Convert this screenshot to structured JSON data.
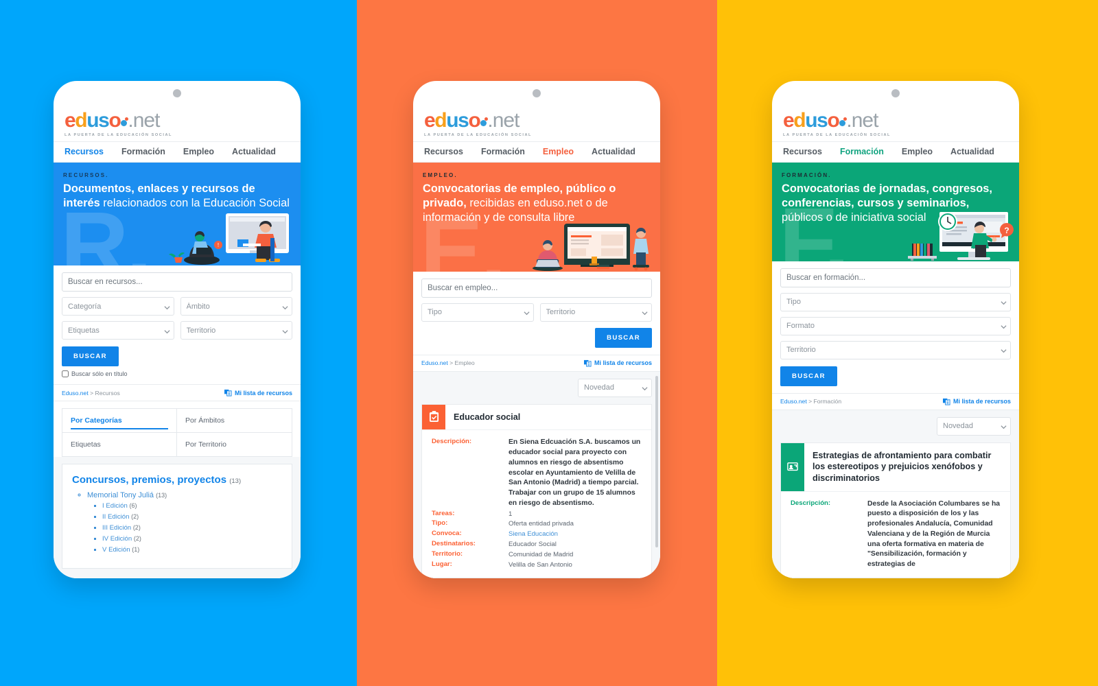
{
  "background": {
    "panel_blue": "#00A6FB",
    "panel_orange": "#FD7643",
    "panel_yellow": "#FFC107"
  },
  "brand": {
    "word_e": "e",
    "word_d": "d",
    "word_u": "u",
    "word_s": "s",
    "word_o": "o",
    "word_net": ".net",
    "tagline": "LA PUERTA DE LA EDUCACIÓN SOCIAL"
  },
  "nav": {
    "recursos": "Recursos",
    "formacion": "Formación",
    "empleo": "Empleo",
    "actualidad": "Actualidad"
  },
  "common": {
    "buscar_button": "BUSCAR",
    "mi_lista": "Mi lista de recursos",
    "sort_value": "Novedad",
    "crumb_root": "Eduso.net",
    "crumb_sep": " > "
  },
  "phone1": {
    "accent": "#1C8EF0",
    "hero": {
      "kicker": "RECURSOS.",
      "title_bold": "Documentos, enlaces y recursos de interés",
      "title_rest": " relacionados con la Educación Social",
      "ghost": "R."
    },
    "search": {
      "placeholder": "Buscar en recursos...",
      "select_categoria": "Categoría",
      "select_ambito": "Ámbito",
      "select_etiquetas": "Etiquetas",
      "select_territorio": "Territorio",
      "checkbox_label": "Buscar sólo en título"
    },
    "crumb_page": "Recursos",
    "tabs": [
      {
        "label": "Por Categorías",
        "active": true
      },
      {
        "label": "Por Ámbitos",
        "active": false
      },
      {
        "label": "Etiquetas",
        "active": false
      },
      {
        "label": "Por Territorio",
        "active": false
      }
    ],
    "result": {
      "title": "Concursos, premios, proyectos",
      "title_count": "(13)",
      "child": {
        "label": "Memorial Tony Juliá",
        "count": "(13)"
      },
      "grandchildren": [
        {
          "label": "I Edición",
          "count": "(6)"
        },
        {
          "label": "II Edición",
          "count": "(2)"
        },
        {
          "label": "III Edición",
          "count": "(2)"
        },
        {
          "label": "IV Edición",
          "count": "(2)"
        },
        {
          "label": "V Edición",
          "count": "(1)"
        }
      ]
    }
  },
  "phone2": {
    "accent": "#FB7046",
    "hero": {
      "kicker": "EMPLEO.",
      "title_bold": "Convocatorias de empleo, público o privado,",
      "title_rest": " recibidas en eduso.net o de información y de consulta libre",
      "ghost": "E."
    },
    "search": {
      "placeholder": "Buscar en empleo...",
      "select_tipo": "Tipo",
      "select_territorio": "Territorio"
    },
    "crumb_page": "Empleo",
    "listing": {
      "icon": "clipboard-check-icon",
      "title": "Educador social",
      "rows": [
        {
          "key": "Descripción:",
          "value": "En Siena Edcuación S.A. buscamos un educador social para proyecto con alumnos en riesgo de absentismo escolar en Ayuntamiento de Velilla de San Antonio (Madrid) a tiempo parcial. Trabajar con un grupo de 15 alumnos en riesgo de absentismo.",
          "emphasis": true
        },
        {
          "key": "Tareas:",
          "value": "1"
        },
        {
          "key": "Tipo:",
          "value": "Oferta entidad privada"
        },
        {
          "key": "Convoca:",
          "value": "Siena Educación",
          "link": true
        },
        {
          "key": "Destinatarios:",
          "value": "Educador Social"
        },
        {
          "key": "Territorio:",
          "value": "Comunidad de Madrid"
        },
        {
          "key": "Lugar:",
          "value": "Velilla de San Antonio"
        }
      ]
    }
  },
  "phone3": {
    "accent": "#0BA678",
    "hero": {
      "kicker": "FORMACIÓN.",
      "title_bold": "Convocatorias de jornadas, congresos, conferencias, cursos y seminarios,",
      "title_rest": " públicos o de iniciativa social",
      "ghost": "F."
    },
    "search": {
      "placeholder": "Buscar en formación...",
      "select_tipo": "Tipo",
      "select_formato": "Formato",
      "select_territorio": "Territorio"
    },
    "crumb_page": "Formación",
    "listing": {
      "icon": "presentation-screen-icon",
      "title": "Estrategias de afrontamiento para combatir los estereotipos y prejuicios xenófobos y discriminatorios",
      "rows": [
        {
          "key": "Descripción:",
          "value": "Desde la Asociación Columbares se ha puesto a disposición de los y las profesionales Andalucía, Comunidad Valenciana y de la Región de Murcia una oferta formativa en materia de \"Sensibilización, formación y estrategias de",
          "emphasis": true
        }
      ]
    }
  }
}
